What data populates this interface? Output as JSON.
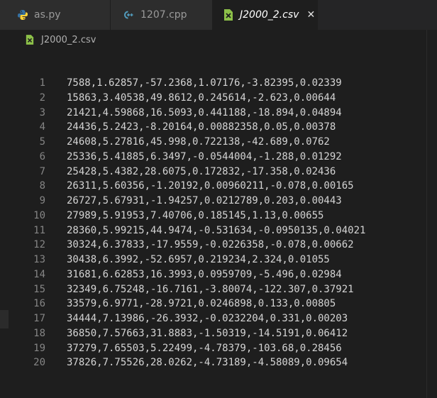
{
  "tabs": [
    {
      "label": "as.py",
      "icon": "python-icon",
      "active": false
    },
    {
      "label": "1207.cpp",
      "icon": "cpp-icon",
      "active": false
    },
    {
      "label": "J2000_2.csv",
      "icon": "csv-icon",
      "active": true
    }
  ],
  "breadcrumb": {
    "label": "J2000_2.csv"
  },
  "colors": {
    "background": "#1e1e1e",
    "tabbar": "#252526",
    "python_blue": "#3572A5",
    "python_yellow": "#FFD43B",
    "cpp": "#519aba",
    "csv_green": "#8dc149"
  },
  "lines": [
    {
      "num": "1",
      "text": "7588,1.62857,-57.2368,1.07176,-3.82395,0.02339"
    },
    {
      "num": "2",
      "text": "15863,3.40538,49.8612,0.245614,-2.623,0.00644"
    },
    {
      "num": "3",
      "text": "21421,4.59868,16.5093,0.441188,-18.894,0.04894"
    },
    {
      "num": "4",
      "text": "24436,5.2423,-8.20164,0.00882358,0.05,0.00378"
    },
    {
      "num": "5",
      "text": "24608,5.27816,45.998,0.722138,-42.689,0.0762"
    },
    {
      "num": "6",
      "text": "25336,5.41885,6.3497,-0.0544004,-1.288,0.01292"
    },
    {
      "num": "7",
      "text": "25428,5.4382,28.6075,0.172832,-17.358,0.02436"
    },
    {
      "num": "8",
      "text": "26311,5.60356,-1.20192,0.00960211,-0.078,0.00165"
    },
    {
      "num": "9",
      "text": "26727,5.67931,-1.94257,0.0212789,0.203,0.00443"
    },
    {
      "num": "10",
      "text": "27989,5.91953,7.40706,0.185145,1.13,0.00655"
    },
    {
      "num": "11",
      "text": "28360,5.99215,44.9474,-0.531634,-0.0950135,0.04021"
    },
    {
      "num": "12",
      "text": "30324,6.37833,-17.9559,-0.0226358,-0.078,0.00662"
    },
    {
      "num": "13",
      "text": "30438,6.3992,-52.6957,0.219234,2.324,0.01055"
    },
    {
      "num": "14",
      "text": "31681,6.62853,16.3993,0.0959709,-5.496,0.02984"
    },
    {
      "num": "15",
      "text": "32349,6.75248,-16.7161,-3.80074,-122.307,0.37921"
    },
    {
      "num": "16",
      "text": "33579,6.9771,-28.9721,0.0246898,0.133,0.00805"
    },
    {
      "num": "17",
      "text": "34444,7.13986,-26.3932,-0.0232204,0.331,0.00203"
    },
    {
      "num": "18",
      "text": "36850,7.57663,31.8883,-1.50319,-14.5191,0.06412"
    },
    {
      "num": "19",
      "text": "37279,7.65503,5.22499,-4.78379,-103.68,0.28456"
    },
    {
      "num": "20",
      "text": "37826,7.75526,28.0262,-4.73189,-4.58089,0.09654"
    }
  ]
}
